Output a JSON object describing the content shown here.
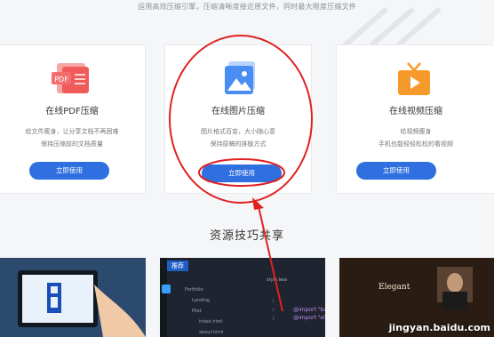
{
  "header": {
    "subtitle": "运用高效压缩引擎，压缩清晰度接近原文件，同时最大限度压缩文件"
  },
  "cards": [
    {
      "title": "在线PDF压缩",
      "desc1": "给文件瘦身，让分享文档不再困难",
      "desc2": "保持压缩前的文档质量",
      "button": "立即使用",
      "icon_text": "PDF"
    },
    {
      "title": "在线图片压缩",
      "desc1": "图片格式百变，大小随心意",
      "desc2": "保持原稿的排版方式",
      "button": "立即使用"
    },
    {
      "title": "在线视频压缩",
      "desc1": "给视频瘦身",
      "desc2": "手机也能轻轻松松的看视频",
      "button": "立即使用"
    }
  ],
  "resources": {
    "heading": "资源技巧共享",
    "tags": [
      "推荐",
      "推荐"
    ],
    "editor": {
      "tab": "style.less",
      "tree": [
        "Portfolio",
        "Landing",
        "Pilot",
        "index.html",
        "about.html"
      ],
      "line_numbers": [
        "1",
        "2",
        "3"
      ],
      "code": [
        "@import \"ba",
        "@import \"ele"
      ]
    },
    "video_title": "Elegant"
  },
  "watermark": "jingyan.baidu.com",
  "colors": {
    "accent": "#2f6fe0",
    "annotation": "#e02020"
  }
}
